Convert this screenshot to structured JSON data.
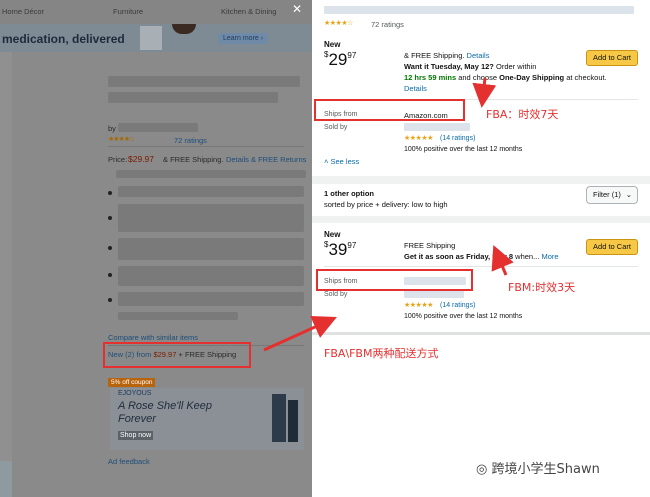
{
  "nav": {
    "items": [
      "Home Décor",
      "Furniture",
      "Kitchen & Dining"
    ]
  },
  "banner": {
    "text": "medication, delivered",
    "cta": "Learn more ›"
  },
  "product": {
    "by": "by",
    "ratings": "72 ratings",
    "price_label": "Price:",
    "price": "$29.97",
    "free_shipping": "& FREE Shipping.",
    "details": "Details",
    "free_returns": "& FREE Returns",
    "compare": "Compare with similar items",
    "new_from_prefix": "New (2) from",
    "new_from_price": "$29.97",
    "new_from_suffix": "+ FREE Shipping",
    "coupon": "5% off coupon",
    "ad_brand": "EJOYOUS",
    "ad_title": "A Rose She'll Keep Forever",
    "ad_shop": "Shop now",
    "ad_feedback": "Ad feedback"
  },
  "panel": {
    "ratings": "72 ratings",
    "offer1": {
      "condition": "New",
      "currency": "$",
      "price_whole": "29",
      "price_fraction": "97",
      "shipping": "& FREE Shipping.",
      "details": "Details",
      "want_it": "Want it Tuesday, May 12?",
      "order_within": "Order within",
      "countdown": "12 hrs 59 mins",
      "choose": "and choose",
      "oneday": "One-Day Shipping",
      "at_checkout": "at checkout.",
      "details2": "Details",
      "add_to_cart": "Add to Cart",
      "ships_from_label": "Ships from",
      "ships_from_value": "Amazon.com",
      "sold_by_label": "Sold by",
      "feedback_count": "(14 ratings)",
      "positive": "100% positive over the last 12 months",
      "see_less": "See less"
    },
    "other": {
      "count": "1 other option",
      "sorted": "sorted by price + delivery: low to high",
      "filter": "Filter (1)"
    },
    "offer2": {
      "condition": "New",
      "currency": "$",
      "price_whole": "39",
      "price_fraction": "97",
      "shipping": "FREE Shipping",
      "get_it": "Get it as soon as Friday, May 8",
      "when": "when...",
      "more": "More",
      "add_to_cart": "Add to Cart",
      "ships_from_label": "Ships from",
      "sold_by_label": "Sold by",
      "feedback_count": "(14 ratings)",
      "positive": "100% positive over the last 12 months"
    }
  },
  "annotations": {
    "fba": "FBA：时效7天",
    "fbm": "FBM:时效3天",
    "both": "FBA\\FBM两种配送方式"
  },
  "watermark": "跨境小学生Shawn",
  "colors": {
    "annotation_red": "#e53030",
    "link_blue": "#0a6ba8",
    "cart_yellow": "#f6c845",
    "star_orange": "#e8a317"
  }
}
